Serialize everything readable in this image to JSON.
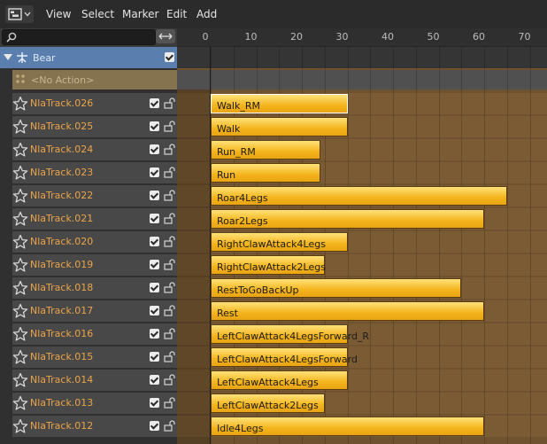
{
  "menu": {
    "editor_type_icon": "nla-editor-icon",
    "items": [
      "View",
      "Select",
      "Marker",
      "Edit",
      "Add"
    ]
  },
  "search": {
    "placeholder": ""
  },
  "ruler": {
    "frames": [
      "0",
      "10",
      "20",
      "30",
      "40",
      "50",
      "60",
      "70"
    ]
  },
  "object": {
    "name": "Bear",
    "enabled": true
  },
  "action": {
    "label": "<No Action>"
  },
  "tracks": [
    {
      "name": "NlaTrack.026",
      "strip": "Walk_RM",
      "start": 0,
      "end": 30,
      "selected": true
    },
    {
      "name": "NlaTrack.025",
      "strip": "Walk",
      "start": 0,
      "end": 30
    },
    {
      "name": "NlaTrack.024",
      "strip": "Run_RM",
      "start": 0,
      "end": 24
    },
    {
      "name": "NlaTrack.023",
      "strip": "Run",
      "start": 0,
      "end": 24
    },
    {
      "name": "NlaTrack.022",
      "strip": "Roar4Legs",
      "start": 0,
      "end": 65
    },
    {
      "name": "NlaTrack.021",
      "strip": "Roar2Legs",
      "start": 0,
      "end": 60
    },
    {
      "name": "NlaTrack.020",
      "strip": "RightClawAttack4Legs",
      "start": 0,
      "end": 30
    },
    {
      "name": "NlaTrack.019",
      "strip": "RightClawAttack2Legs",
      "start": 0,
      "end": 25
    },
    {
      "name": "NlaTrack.018",
      "strip": "RestToGoBackUp",
      "start": 0,
      "end": 55
    },
    {
      "name": "NlaTrack.017",
      "strip": "Rest",
      "start": 0,
      "end": 60
    },
    {
      "name": "NlaTrack.016",
      "strip": "LeftClawAttack4LegsForward_R",
      "start": 0,
      "end": 30
    },
    {
      "name": "NlaTrack.015",
      "strip": "LeftClawAttack4LegsForward",
      "start": 0,
      "end": 30
    },
    {
      "name": "NlaTrack.014",
      "strip": "LeftClawAttack4Legs",
      "start": 0,
      "end": 30
    },
    {
      "name": "NlaTrack.013",
      "strip": "LeftClawAttack2Legs",
      "start": 0,
      "end": 25
    },
    {
      "name": "NlaTrack.012",
      "strip": "Idle4Legs",
      "start": 0,
      "end": 60
    }
  ],
  "colors": {
    "track_name": "#eba449",
    "strip": "#f4b41c",
    "object_row": "#5a7fae"
  }
}
